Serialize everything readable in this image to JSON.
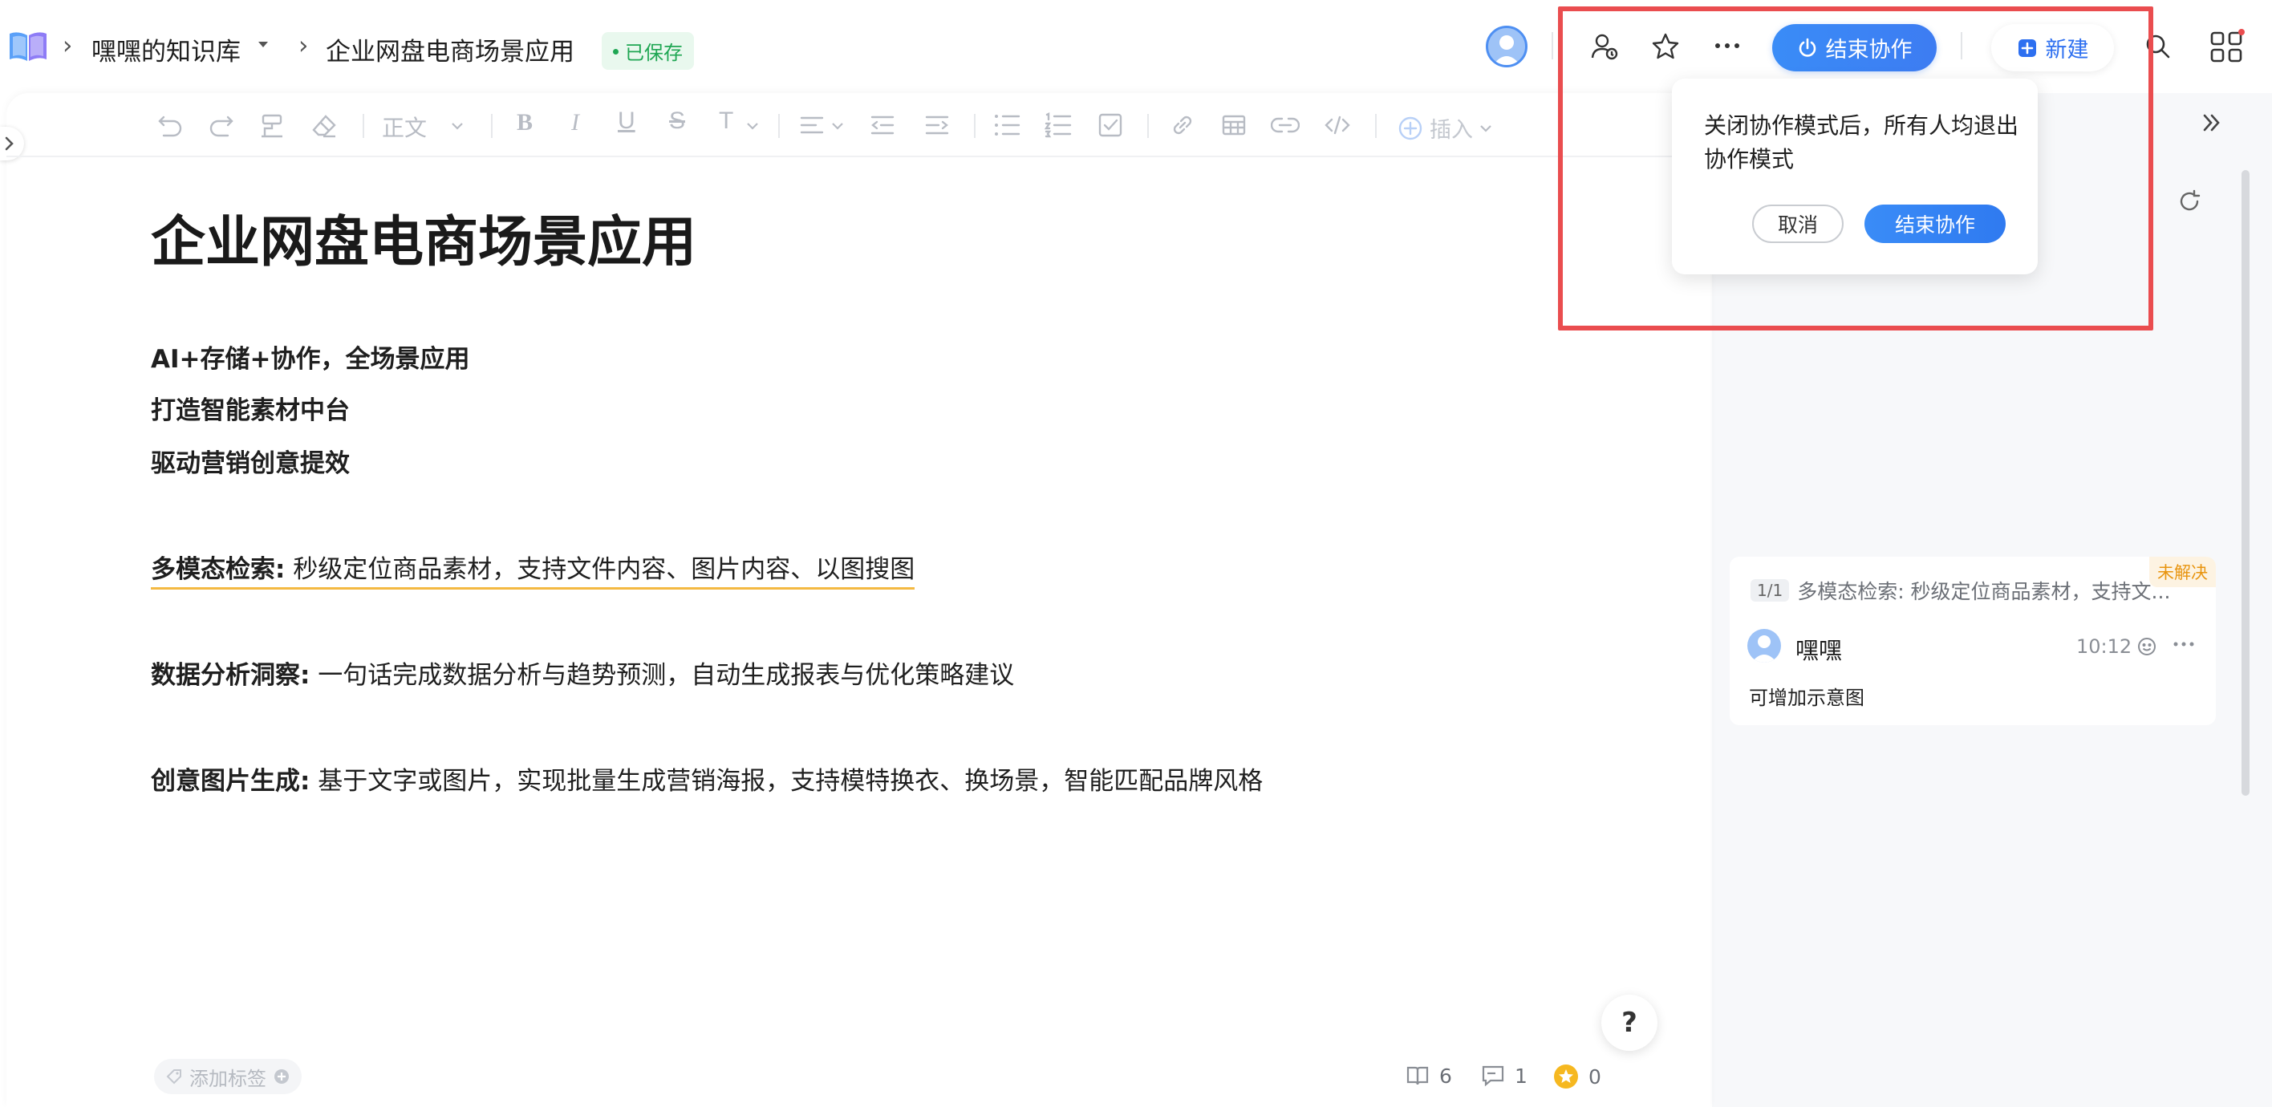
{
  "header": {
    "breadcrumb": [
      {
        "label": "嘿嘿的知识库"
      },
      {
        "label": "企业网盘电商场景应用"
      }
    ],
    "saved_status": "已保存",
    "end_collab_button": "结束协作",
    "new_button": "新建"
  },
  "toolbar": {
    "paragraph_style": "正文",
    "insert_label": "插入"
  },
  "document": {
    "title": "企业网盘电商场景应用",
    "intro_lines": [
      "AI+存储+协作，全场景应用",
      "打造智能素材中台",
      "驱动营销创意提效"
    ],
    "features": [
      {
        "title": "多模态检索:",
        "desc": " 秒级定位商品素材，支持文件内容、图片内容、以图搜图"
      },
      {
        "title": "数据分析洞察:",
        "desc": " 一句话完成数据分析与趋势预测，自动生成报表与优化策略建议"
      },
      {
        "title": "创意图片生成:",
        "desc": " 基于文字或图片，实现批量生成营销海报，支持模特换衣、换场景，智能匹配品牌风格"
      }
    ]
  },
  "popup": {
    "message": "关闭协作模式后，所有人均退出协作模式",
    "cancel_label": "取消",
    "confirm_label": "结束协作"
  },
  "comment": {
    "counter": "1/1",
    "quote": "多模态检索: 秒级定位商品素材，支持文...",
    "status": "未解决",
    "author": "嘿嘿",
    "time": "10:12",
    "text": "可增加示意图"
  },
  "footer": {
    "add_tag": "添加标签",
    "views": "6",
    "comments": "1",
    "likes": "0"
  },
  "help_label": "?",
  "colors": {
    "accent": "#3a8cf7",
    "highlight_box": "#ea4d4f",
    "saved_green": "#1fa653",
    "unresolved_orange": "#e8940f"
  }
}
